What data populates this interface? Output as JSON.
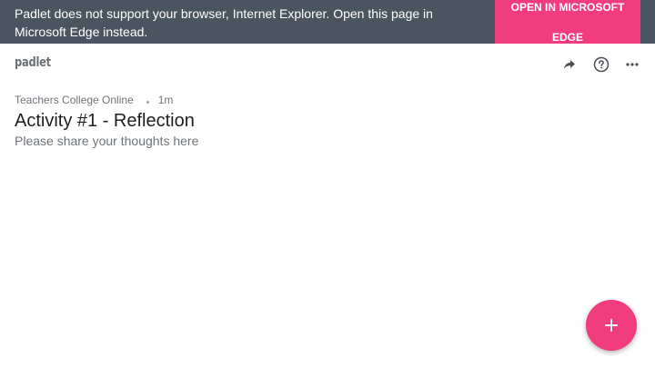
{
  "banner": {
    "message": "Padlet does not support your browser, Internet Explorer. Open this page in Microsoft Edge instead.",
    "button_line1": "OPEN IN MICROSOFT",
    "button_line2": "EDGE"
  },
  "topbar": {
    "logo": "padlet",
    "icons": [
      "share-icon",
      "help-icon",
      "more-icon"
    ]
  },
  "board": {
    "author": "Teachers College Online",
    "time_ago": "1m",
    "title": "Activity #1 - Reflection",
    "description": "Please share your thoughts here"
  },
  "fab": {
    "icon": "plus-icon"
  },
  "colors": {
    "banner_bg": "#4a5560",
    "accent": "#f13d7d",
    "title_text": "#1d1f21",
    "muted_text": "#6f7479"
  }
}
